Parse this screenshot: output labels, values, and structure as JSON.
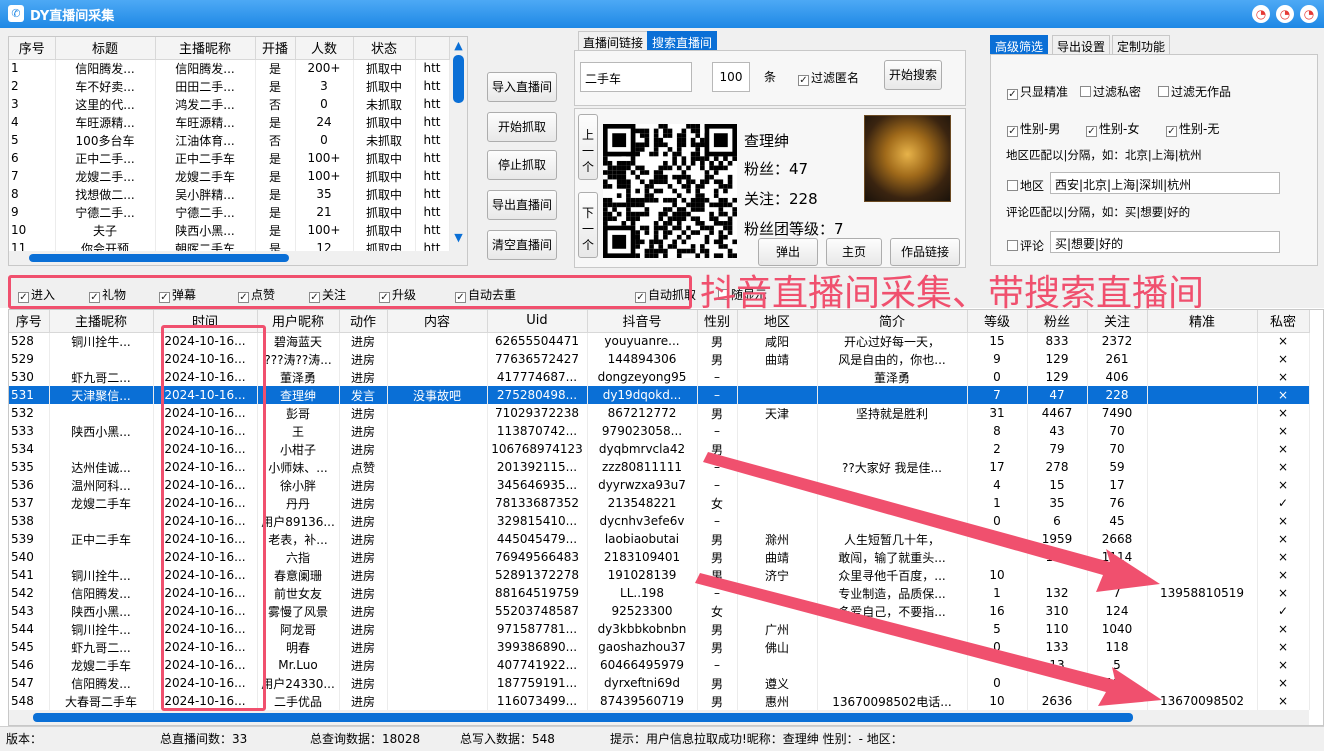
{
  "app": {
    "title": "DY直播间采集"
  },
  "top_table": {
    "headers": [
      "序号",
      "标题",
      "主播昵称",
      "开播",
      "人数",
      "状态",
      ""
    ],
    "rows": [
      [
        "1",
        "信阳腾发...",
        "信阳腾发...",
        "是",
        "200+",
        "抓取中",
        "htt"
      ],
      [
        "2",
        "车不好卖...",
        "田田二手...",
        "是",
        "3",
        "抓取中",
        "htt"
      ],
      [
        "3",
        "这里的代...",
        "鸿发二手...",
        "否",
        "0",
        "未抓取",
        "htt"
      ],
      [
        "4",
        "车旺源精...",
        "车旺源精...",
        "是",
        "24",
        "抓取中",
        "htt"
      ],
      [
        "5",
        "100多台车",
        "江油体育...",
        "否",
        "0",
        "未抓取",
        "htt"
      ],
      [
        "6",
        "正中二手...",
        "正中二手车",
        "是",
        "100+",
        "抓取中",
        "htt"
      ],
      [
        "7",
        "龙嫂二手...",
        "龙嫂二手车",
        "是",
        "100+",
        "抓取中",
        "htt"
      ],
      [
        "8",
        "找想做二...",
        "吴小胖精...",
        "是",
        "35",
        "抓取中",
        "htt"
      ],
      [
        "9",
        "宁德二手...",
        "宁德二手...",
        "是",
        "21",
        "抓取中",
        "htt"
      ],
      [
        "10",
        "夫子",
        "陕西小黑...",
        "是",
        "100+",
        "抓取中",
        "htt"
      ],
      [
        "11",
        "你会开预",
        "朝晖二手车",
        "是",
        "12",
        "抓取中",
        "htt"
      ]
    ]
  },
  "mid_buttons": [
    "导入直播间",
    "开始抓取",
    "停止抓取",
    "导出直播间",
    "清空直播间"
  ],
  "search": {
    "tabs": [
      "直播间链接",
      "搜索直播间"
    ],
    "keyword": "二手车",
    "count": "100",
    "count_unit": "条",
    "filter_anon": "过滤匿名",
    "search_button": "开始搜索"
  },
  "profile": {
    "prev": "上一个",
    "next": "下一个",
    "name": "查理绅",
    "fans": "粉丝：47",
    "follow": "关注：228",
    "fanclub": "粉丝团等级：7",
    "popup_btn": "弹出",
    "home_btn": "主页",
    "works_btn": "作品链接"
  },
  "advanced": {
    "tabs": [
      "高级筛选",
      "导出设置",
      "定制功能"
    ],
    "only_exact": "只显精准",
    "filter_private": "过滤私密",
    "filter_noworks": "过滤无作品",
    "gender_male": "性别-男",
    "gender_female": "性别-女",
    "gender_none": "性别-无",
    "region_hint": "地区匹配以|分隔，如：北京|上海|杭州",
    "region_label": "地区",
    "region_value": "西安|北京|上海|深圳|杭州",
    "comment_hint": "评论匹配以|分隔，如：买|想要|好的",
    "comment_label": "评论",
    "comment_value": "买|想要|好的"
  },
  "filters": {
    "enter": "进入",
    "gift": "礼物",
    "danmu": "弹幕",
    "like": "点赞",
    "follow": "关注",
    "upgrade": "升级",
    "dedupe": "自动去重",
    "autograb": "自动抓取",
    "random": "随显示"
  },
  "annotation": "抖音直播间采集、带搜索直播间",
  "main_table": {
    "headers": [
      "序号",
      "主播昵称",
      "时间",
      "用户昵称",
      "动作",
      "内容",
      "Uid",
      "抖音号",
      "性别",
      "地区",
      "简介",
      "等级",
      "粉丝",
      "关注",
      "精准",
      "私密"
    ],
    "rows": [
      [
        "528",
        "铜川拴牛...",
        "2024-10-16...",
        "碧海蓝天",
        "进房",
        "",
        "62655504471",
        "youyuanre...",
        "男",
        "咸阳",
        "开心过好每一天，",
        "15",
        "833",
        "2372",
        "",
        "×"
      ],
      [
        "529",
        "",
        "2024-10-16...",
        "???涛??涛...",
        "进房",
        "",
        "77636572427",
        "144894306",
        "男",
        "曲靖",
        "风是自由的，你也...",
        "9",
        "129",
        "261",
        "",
        "×"
      ],
      [
        "530",
        "虾九哥二...",
        "2024-10-16...",
        "董泽勇",
        "进房",
        "",
        "417774687...",
        "dongzeyong95",
        "–",
        "",
        "董泽勇",
        "0",
        "129",
        "406",
        "",
        "×"
      ],
      [
        "531",
        "天津聚信...",
        "2024-10-16...",
        "查理绅",
        "发言",
        "没事故吧",
        "275280498...",
        "dy19dqokd...",
        "–",
        "",
        "",
        "7",
        "47",
        "228",
        "",
        "×"
      ],
      [
        "532",
        "",
        "2024-10-16...",
        "彭哥",
        "进房",
        "",
        "71029372238",
        "867212772",
        "男",
        "天津",
        "坚持就是胜利",
        "31",
        "4467",
        "7490",
        "",
        "×"
      ],
      [
        "533",
        "陕西小黑...",
        "2024-10-16...",
        "王",
        "进房",
        "",
        "113870742...",
        "979023058...",
        "–",
        "",
        "",
        "8",
        "43",
        "70",
        "",
        "×"
      ],
      [
        "534",
        "",
        "2024-10-16...",
        "小柑子",
        "进房",
        "",
        "106768974123",
        "dyqbmrvcla42",
        "男",
        "",
        "",
        "2",
        "79",
        "70",
        "",
        "×"
      ],
      [
        "535",
        "达州佳诚...",
        "2024-10-16...",
        "小师妹、...",
        "点赞",
        "",
        "201392115...",
        "zzz80811111",
        "–",
        "",
        "??大家好 我是佳...",
        "17",
        "278",
        "59",
        "",
        "×"
      ],
      [
        "536",
        "温州阿科...",
        "2024-10-16...",
        "徐小胖",
        "进房",
        "",
        "345646935...",
        "dyyrwzxa93u7",
        "–",
        "",
        "",
        "4",
        "15",
        "17",
        "",
        "×"
      ],
      [
        "537",
        "龙嫂二手车",
        "2024-10-16...",
        "丹丹",
        "进房",
        "",
        "78133687352",
        "213548221",
        "女",
        "",
        "",
        "1",
        "35",
        "76",
        "",
        "✓"
      ],
      [
        "538",
        "",
        "2024-10-16...",
        "用户89136...",
        "进房",
        "",
        "329815410...",
        "dycnhv3efe6v",
        "–",
        "",
        "",
        "0",
        "6",
        "45",
        "",
        "×"
      ],
      [
        "539",
        "正中二手车",
        "2024-10-16...",
        "老表，补...",
        "进房",
        "",
        "445045479...",
        "laobiaobutai",
        "男",
        "滁州",
        "人生短暂几十年，",
        "11",
        "1959",
        "2668",
        "",
        "×"
      ],
      [
        "540",
        "",
        "2024-10-16...",
        "六指",
        "进房",
        "",
        "76949566483",
        "2183109401",
        "男",
        "曲靖",
        "敢闯，输了就重头...",
        "",
        "124",
        "1114",
        "",
        "×"
      ],
      [
        "541",
        "铜川拴牛...",
        "2024-10-16...",
        "春意阑珊",
        "进房",
        "",
        "52891372278",
        "191028139",
        "男",
        "济宁",
        "众里寻他千百度，...",
        "10",
        "",
        "536",
        "",
        "×"
      ],
      [
        "542",
        "信阳腾发...",
        "2024-10-16...",
        "前世女友",
        "进房",
        "",
        "88164519759",
        "LL..198",
        "–",
        "",
        "专业制造，品质保...",
        "1",
        "132",
        "7",
        "13958810519",
        "×"
      ],
      [
        "543",
        "陕西小黑...",
        "2024-10-16...",
        "雾慢了风景",
        "进房",
        "",
        "55203748587",
        "92523300",
        "女",
        "",
        "多爱自己，不要指...",
        "16",
        "310",
        "124",
        "",
        "✓"
      ],
      [
        "544",
        "铜川拴牛...",
        "2024-10-16...",
        "阿龙哥",
        "进房",
        "",
        "971587781...",
        "dy3kbbkobnbn",
        "男",
        "广州",
        "",
        "5",
        "110",
        "1040",
        "",
        "×"
      ],
      [
        "545",
        "虾九哥二...",
        "2024-10-16...",
        "明春",
        "进房",
        "",
        "399386890...",
        "gaoshazhou37",
        "男",
        "佛山",
        "",
        "0",
        "133",
        "118",
        "",
        "×"
      ],
      [
        "546",
        "龙嫂二手车",
        "2024-10-16...",
        "Mr.Luo",
        "进房",
        "",
        "407741922...",
        "60466495979",
        "–",
        "",
        "",
        "",
        "13",
        "5",
        "",
        "×"
      ],
      [
        "547",
        "信阳腾发...",
        "2024-10-16...",
        "用户24330...",
        "进房",
        "",
        "187759191...",
        "dyrxeftni69d",
        "男",
        "遵义",
        "",
        "0",
        "",
        "196",
        "",
        "×"
      ],
      [
        "548",
        "大春哥二手车",
        "2024-10-16...",
        "二手优品",
        "进房",
        "",
        "116073499...",
        "87439560719",
        "男",
        "惠州",
        "13670098502电话...",
        "10",
        "2636",
        "",
        "13670098502",
        "×"
      ]
    ]
  },
  "status": {
    "version": "版本：",
    "total_rooms": "总直播间数：33",
    "total_query": "总查询数据：18028",
    "total_write": "总写入数据：548",
    "hint": "提示：用户信息拉取成功!昵称：查理绅 性别：- 地区："
  },
  "colors": {
    "accent": "#0a6fd6",
    "annotation": "#f0506e",
    "titlebar": "#2b8fe8"
  }
}
